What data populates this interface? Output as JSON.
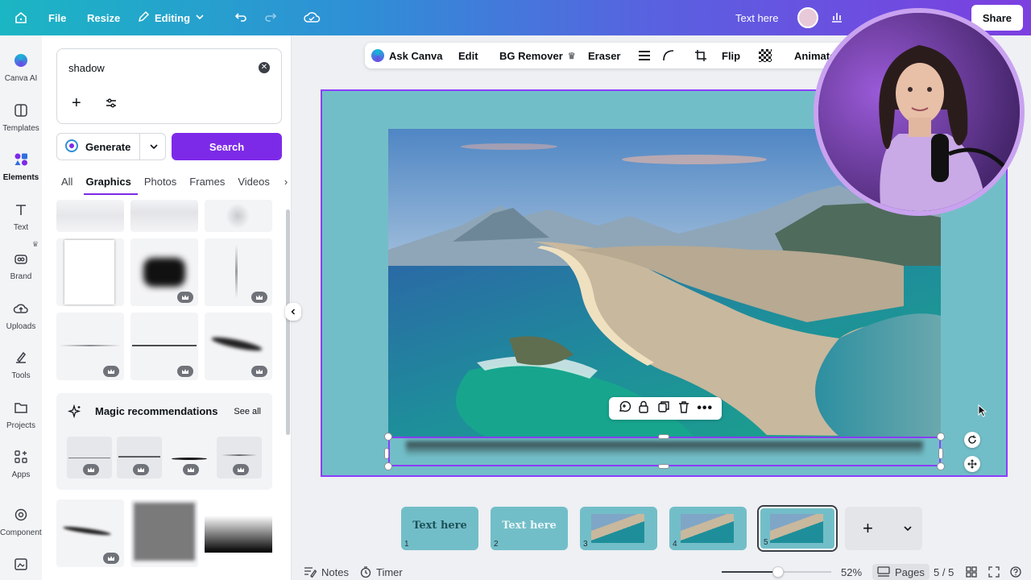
{
  "topbar": {
    "file_label": "File",
    "resize_label": "Resize",
    "editing_label": "Editing",
    "text_here_label": "Text here",
    "share_label": "Share"
  },
  "rail": {
    "items": [
      {
        "label": "Canva AI"
      },
      {
        "label": "Templates"
      },
      {
        "label": "Elements"
      },
      {
        "label": "Text"
      },
      {
        "label": "Brand"
      },
      {
        "label": "Uploads"
      },
      {
        "label": "Tools"
      },
      {
        "label": "Projects"
      },
      {
        "label": "Apps"
      },
      {
        "label": "Components"
      }
    ]
  },
  "panel": {
    "search_value": "shadow",
    "generate_label": "Generate",
    "search_label": "Search",
    "tabs": [
      "All",
      "Graphics",
      "Photos",
      "Frames",
      "Videos"
    ],
    "magic_title": "Magic recommendations",
    "see_all": "See all"
  },
  "context_toolbar": {
    "ask_canva": "Ask Canva",
    "edit": "Edit",
    "bg_remover": "BG Remover",
    "eraser": "Eraser",
    "flip": "Flip",
    "animate": "Animate"
  },
  "pages": [
    {
      "num": "1",
      "text": "Text here"
    },
    {
      "num": "2",
      "text": "Text here"
    },
    {
      "num": "3",
      "text": ""
    },
    {
      "num": "4",
      "text": ""
    },
    {
      "num": "5",
      "text": ""
    }
  ],
  "bottombar": {
    "notes": "Notes",
    "timer": "Timer",
    "zoom": "52%",
    "zoom_level": 0.52,
    "pages_label": "Pages",
    "page_count": "5 / 5"
  },
  "colors": {
    "accent": "#7d2ae8",
    "selection": "#8b3dff",
    "page_bg": "#72bec8"
  }
}
